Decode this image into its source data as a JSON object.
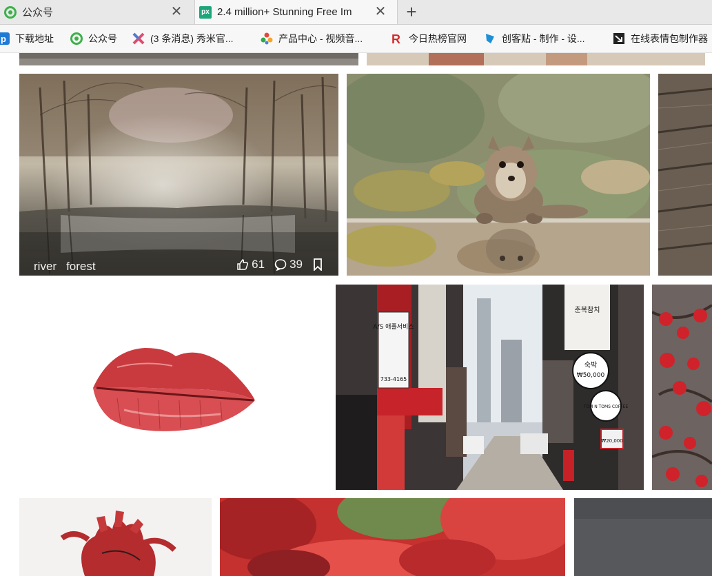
{
  "tabs": [
    {
      "title": "公众号",
      "icon": "wechat-official-icon",
      "active": false
    },
    {
      "title": "2.4 million+ Stunning Free Im",
      "icon": "pexels-px-icon",
      "active": true
    }
  ],
  "favicon_text": "px",
  "close_glyph": "✕",
  "new_tab_glyph": "+",
  "bookmarks": [
    {
      "label": "下载地址",
      "icon": "p-blue-icon"
    },
    {
      "label": "公众号",
      "icon": "wechat-official-icon"
    },
    {
      "label": "(3 条消息) 秀米官...",
      "icon": "xiumi-icon"
    },
    {
      "label": "产品中心 - 视频音...",
      "icon": "colorful-flower-icon"
    },
    {
      "label": "今日热榜官网",
      "icon": "r-red-icon"
    },
    {
      "label": "创客贴 - 制作 - 设...",
      "icon": "chuangkit-icon"
    },
    {
      "label": "在线表情包制作器",
      "icon": "arrow-box-icon"
    }
  ],
  "photo_card": {
    "tags": [
      "river",
      "forest"
    ],
    "likes": "61",
    "comments": "39"
  },
  "photos": [
    {
      "subject": "forest river"
    },
    {
      "subject": "squirrel reflection"
    },
    {
      "subject": "wood planks"
    },
    {
      "subject": "red lips"
    },
    {
      "subject": "korean city street"
    },
    {
      "subject": "red berries"
    },
    {
      "subject": "anatomical heart"
    },
    {
      "subject": "red leaves"
    },
    {
      "subject": "dark gray"
    }
  ],
  "street_signs": {
    "left_sign": "A/S 애플서비스",
    "left_phone": "733-4165",
    "right_top": "춘복참치",
    "price_sign_title": "숙박",
    "price_sign_value": "₩50,000",
    "coffee": "TOM N TOMS COFFEE",
    "small_price": "₩20,000"
  },
  "colors": {
    "accent_green": "#1fa57a",
    "tab_bar": "#e8e8e8",
    "bookmark_bar": "#f7f7f7"
  }
}
